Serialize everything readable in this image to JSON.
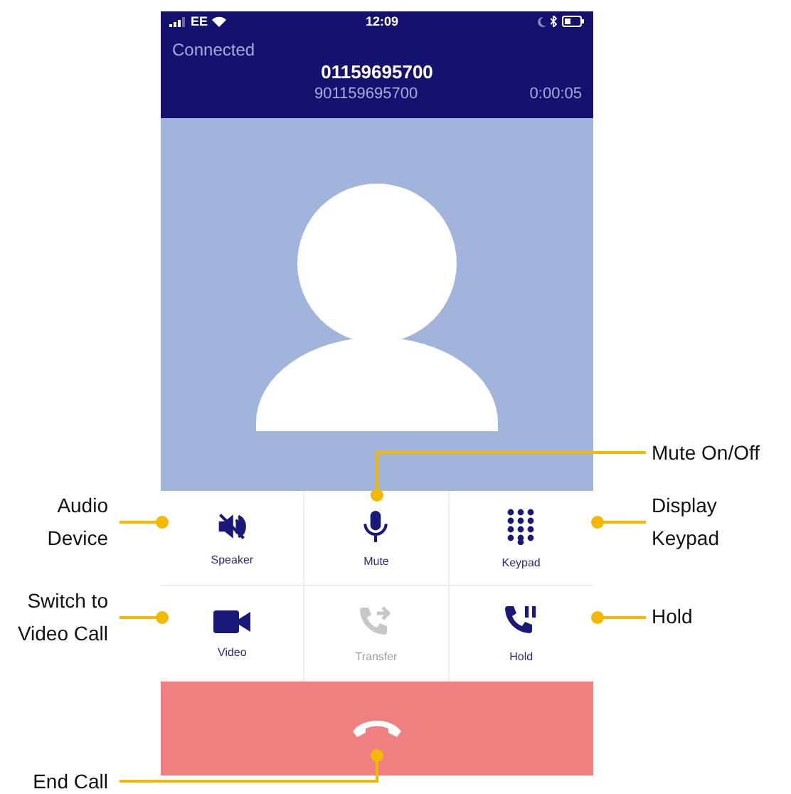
{
  "status_bar": {
    "carrier": "EE",
    "time": "12:09"
  },
  "call": {
    "status": "Connected",
    "number": "01159695700",
    "dialed": "901159695700",
    "duration": "0:00:05"
  },
  "controls": [
    {
      "kind": "speaker",
      "label": "Speaker",
      "disabled": false,
      "callout": "Audio Device"
    },
    {
      "kind": "mute",
      "label": "Mute",
      "disabled": false,
      "callout": "Mute On/Off"
    },
    {
      "kind": "keypad",
      "label": "Keypad",
      "disabled": false,
      "callout": "Display Keypad"
    },
    {
      "kind": "video",
      "label": "Video",
      "disabled": false,
      "callout": "Switch to Video Call"
    },
    {
      "kind": "transfer",
      "label": "Transfer",
      "disabled": true
    },
    {
      "kind": "hold",
      "label": "Hold",
      "disabled": false,
      "callout": "Hold"
    }
  ],
  "end_call": {
    "callout": "End Call"
  }
}
